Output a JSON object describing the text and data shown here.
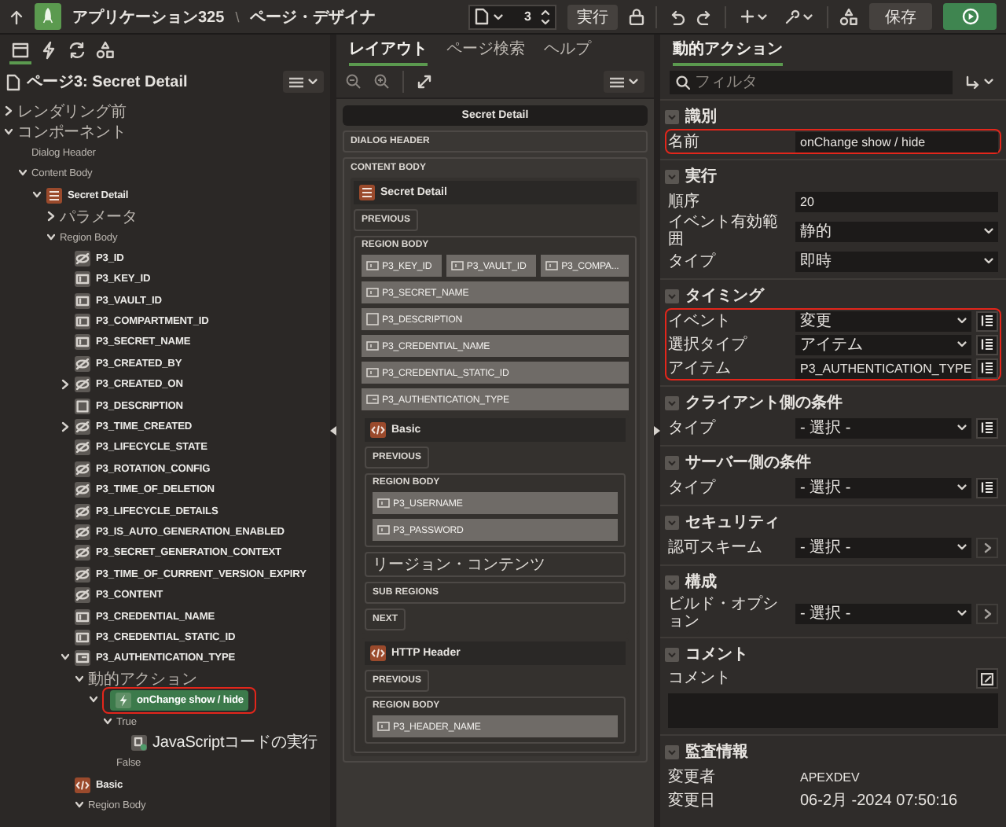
{
  "header": {
    "app_title": "アプリケーション325",
    "separator": "\\",
    "page_title": "ページ・デザイナ",
    "page_number": "3",
    "run_label": "実行",
    "save_label": "保存"
  },
  "left_panel": {
    "tabs": [
      {
        "kind": "rendering",
        "selected": true
      },
      {
        "kind": "dynamic_actions",
        "selected": false
      },
      {
        "kind": "processing",
        "selected": false
      },
      {
        "kind": "shared",
        "selected": false
      }
    ],
    "page_heading": "ページ3: Secret Detail",
    "tree": [
      {
        "label": "レンダリング前",
        "kind": "group",
        "expanded": false,
        "selected": false
      },
      {
        "label": "コンポーネント",
        "kind": "group",
        "expanded": true,
        "selected": false,
        "children": [
          {
            "label": "Dialog Header",
            "kind": "group",
            "selected": false
          },
          {
            "label": "Content Body",
            "kind": "group",
            "expanded": true,
            "selected": false,
            "children": [
              {
                "label": "Secret Detail",
                "kind": "region",
                "expanded": true,
                "selected": false,
                "children": [
                  {
                    "label": "パラメータ",
                    "kind": "group",
                    "expanded": false,
                    "selected": false
                  },
                  {
                    "label": "Region Body",
                    "kind": "group",
                    "expanded": true,
                    "selected": false,
                    "children": [
                      {
                        "label": "P3_ID",
                        "kind": "hidden",
                        "selected": false
                      },
                      {
                        "label": "P3_KEY_ID",
                        "kind": "text",
                        "selected": false
                      },
                      {
                        "label": "P3_VAULT_ID",
                        "kind": "text",
                        "selected": false
                      },
                      {
                        "label": "P3_COMPARTMENT_ID",
                        "kind": "text",
                        "selected": false
                      },
                      {
                        "label": "P3_SECRET_NAME",
                        "kind": "text",
                        "selected": false
                      },
                      {
                        "label": "P3_CREATED_BY",
                        "kind": "hidden",
                        "selected": false
                      },
                      {
                        "label": "P3_CREATED_ON",
                        "kind": "hidden",
                        "expanded": false,
                        "selected": false
                      },
                      {
                        "label": "P3_DESCRIPTION",
                        "kind": "textarea",
                        "selected": false
                      },
                      {
                        "label": "P3_TIME_CREATED",
                        "kind": "hidden",
                        "expanded": false,
                        "selected": false
                      },
                      {
                        "label": "P3_LIFECYCLE_STATE",
                        "kind": "hidden",
                        "selected": false
                      },
                      {
                        "label": "P3_ROTATION_CONFIG",
                        "kind": "hidden",
                        "selected": false
                      },
                      {
                        "label": "P3_TIME_OF_DELETION",
                        "kind": "hidden",
                        "selected": false
                      },
                      {
                        "label": "P3_LIFECYCLE_DETAILS",
                        "kind": "hidden",
                        "selected": false
                      },
                      {
                        "label": "P3_IS_AUTO_GENERATION_ENABLED",
                        "kind": "hidden",
                        "selected": false
                      },
                      {
                        "label": "P3_SECRET_GENERATION_CONTEXT",
                        "kind": "hidden",
                        "selected": false
                      },
                      {
                        "label": "P3_TIME_OF_CURRENT_VERSION_EXPIRY",
                        "kind": "hidden",
                        "selected": false
                      },
                      {
                        "label": "P3_CONTENT",
                        "kind": "hidden",
                        "selected": false
                      },
                      {
                        "label": "P3_CREDENTIAL_NAME",
                        "kind": "text",
                        "selected": false
                      },
                      {
                        "label": "P3_CREDENTIAL_STATIC_ID",
                        "kind": "text",
                        "selected": false
                      },
                      {
                        "label": "P3_AUTHENTICATION_TYPE",
                        "kind": "select",
                        "expanded": true,
                        "selected": false,
                        "children": [
                          {
                            "label": "動的アクション",
                            "kind": "group",
                            "expanded": true,
                            "selected": false,
                            "children": [
                              {
                                "label": "onChange show / hide",
                                "kind": "action",
                                "expanded": true,
                                "selected": true,
                                "highlighted": true,
                                "children": [
                                  {
                                    "label": "True",
                                    "kind": "group",
                                    "expanded": true,
                                    "selected": false,
                                    "children": [
                                      {
                                        "label": "JavaScriptコードの実行",
                                        "kind": "js",
                                        "selected": false
                                      }
                                    ]
                                  },
                                  {
                                    "label": "False",
                                    "kind": "group",
                                    "selected": false
                                  }
                                ]
                              }
                            ]
                          }
                        ]
                      },
                      {
                        "label": "Basic",
                        "kind": "code",
                        "selected": false,
                        "children": [
                          {
                            "label": "Region Body",
                            "kind": "group",
                            "expanded": true,
                            "selected": false
                          }
                        ]
                      }
                    ]
                  }
                ]
              }
            ]
          }
        ]
      }
    ]
  },
  "layout_panel": {
    "tabs": [
      {
        "label": "レイアウト",
        "selected": true
      },
      {
        "label": "ページ検索",
        "selected": false
      },
      {
        "label": "ヘルプ",
        "selected": false
      }
    ],
    "canvas": {
      "page_title": "Secret Detail",
      "dialog_header": "DIALOG HEADER",
      "content_body": "CONTENT BODY",
      "regions": [
        {
          "title": "Secret Detail",
          "kind": "region",
          "slots_before": [
            {
              "label": "PREVIOUS",
              "kind": "button_position"
            }
          ],
          "body": {
            "label": "REGION BODY",
            "rows": [
              [
                {
                  "label": "P3_KEY_ID",
                  "kind": "text"
                },
                {
                  "label": "P3_VAULT_ID",
                  "kind": "text"
                },
                {
                  "label": "P3_COMPA...",
                  "kind": "text"
                }
              ],
              [
                {
                  "label": "P3_SECRET_NAME",
                  "kind": "text"
                }
              ],
              [
                {
                  "label": "P3_DESCRIPTION",
                  "kind": "textarea"
                }
              ],
              [
                {
                  "label": "P3_CREDENTIAL_NAME",
                  "kind": "text"
                }
              ],
              [
                {
                  "label": "P3_CREDENTIAL_STATIC_ID",
                  "kind": "text"
                }
              ],
              [
                {
                  "label": "P3_AUTHENTICATION_TYPE",
                  "kind": "select"
                }
              ]
            ],
            "regions": [
              {
                "title": "Basic",
                "kind": "code",
                "slots_before": [
                  {
                    "label": "PREVIOUS",
                    "kind": "button_position"
                  }
                ],
                "body": {
                  "label": "REGION BODY",
                  "rows": [
                    [
                      {
                        "label": "P3_USERNAME",
                        "kind": "text"
                      }
                    ],
                    [
                      {
                        "label": "P3_PASSWORD",
                        "kind": "text"
                      }
                    ]
                  ]
                },
                "slots_after": [
                  {
                    "label": "リージョン・コンテンツ",
                    "kind": "content_position"
                  },
                  {
                    "label": "SUB REGIONS",
                    "kind": "content_position"
                  },
                  {
                    "label": "NEXT",
                    "kind": "button_position"
                  }
                ]
              },
              {
                "title": "HTTP Header",
                "kind": "code",
                "slots_before": [
                  {
                    "label": "PREVIOUS",
                    "kind": "button_position"
                  }
                ],
                "body": {
                  "label": "REGION BODY",
                  "rows": [
                    [
                      {
                        "label": "P3_HEADER_NAME",
                        "kind": "text"
                      }
                    ]
                  ]
                }
              }
            ]
          }
        }
      ]
    }
  },
  "property_panel": {
    "tab": {
      "label": "動的アクション",
      "selected": true
    },
    "filter": {
      "placeholder": "フィルタ"
    },
    "sections": [
      {
        "title": "識別",
        "expanded": true,
        "highlighted": true,
        "rows": [
          {
            "label": "名前",
            "kind": "text",
            "value": "onChange show / hide"
          }
        ]
      },
      {
        "title": "実行",
        "expanded": true,
        "rows": [
          {
            "label": "順序",
            "kind": "text",
            "value": "20"
          },
          {
            "label": "イベント有効範囲",
            "kind": "select",
            "value": "静的"
          },
          {
            "label": "タイプ",
            "kind": "select",
            "value": "即時"
          }
        ]
      },
      {
        "title": "タイミング",
        "expanded": true,
        "highlighted": true,
        "rows": [
          {
            "label": "イベント",
            "kind": "select_list",
            "value": "変更"
          },
          {
            "label": "選択タイプ",
            "kind": "select_list",
            "value": "アイテム"
          },
          {
            "label": "アイテム",
            "kind": "text_list",
            "value": "P3_AUTHENTICATION_TYPE"
          }
        ]
      },
      {
        "title": "クライアント側の条件",
        "expanded": true,
        "rows": [
          {
            "label": "タイプ",
            "kind": "select_list",
            "value": "- 選択 -"
          }
        ]
      },
      {
        "title": "サーバー側の条件",
        "expanded": true,
        "rows": [
          {
            "label": "タイプ",
            "kind": "select_list",
            "value": "- 選択 -"
          }
        ]
      },
      {
        "title": "セキュリティ",
        "expanded": true,
        "rows": [
          {
            "label": "認可スキーム",
            "kind": "select_link",
            "value": "- 選択 -"
          }
        ]
      },
      {
        "title": "構成",
        "expanded": true,
        "rows": [
          {
            "label": "ビルド・オプション",
            "kind": "select_link",
            "value": "- 選択 -"
          }
        ]
      },
      {
        "title": "コメント",
        "expanded": true,
        "rows": [
          {
            "label": "コメント",
            "kind": "textarea"
          }
        ]
      },
      {
        "title": "監査情報",
        "expanded": true,
        "rows": [
          {
            "label": "変更者",
            "kind": "readonly",
            "value": "APEXDEV"
          },
          {
            "label": "変更日",
            "kind": "readonly",
            "value": "06-2月 -2024 07:50:16"
          }
        ]
      }
    ]
  }
}
